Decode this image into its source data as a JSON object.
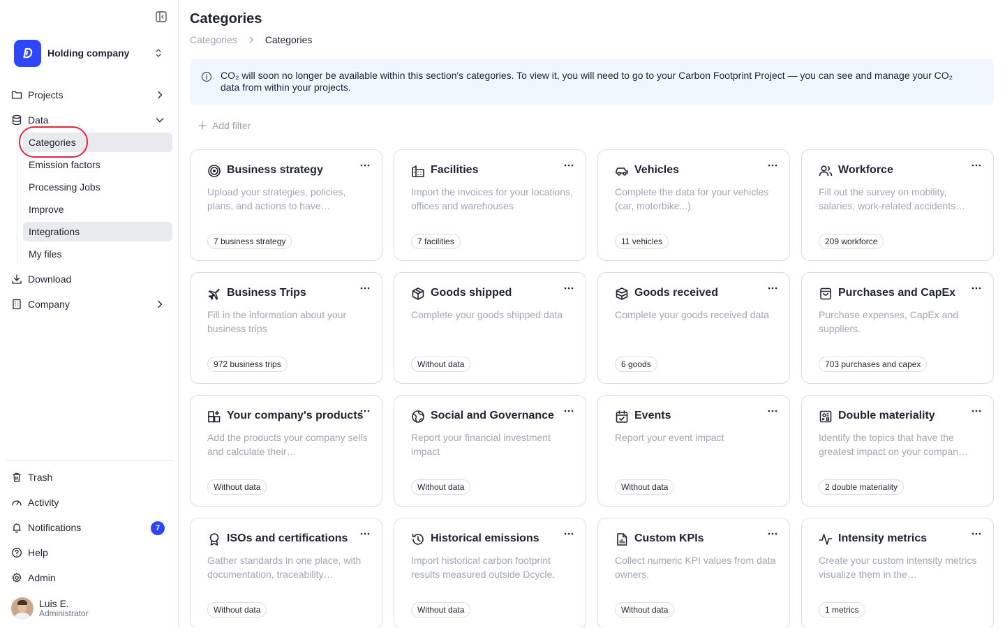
{
  "sidebar": {
    "org_name": "Holding company",
    "nav": {
      "projects": "Projects",
      "data": "Data",
      "download": "Download",
      "company": "Company"
    },
    "data_sub": [
      "Categories",
      "Emission factors",
      "Processing Jobs",
      "Improve",
      "Integrations",
      "My files"
    ],
    "bottom": {
      "trash": "Trash",
      "activity": "Activity",
      "notifications": "Notifications",
      "notifications_count": "7",
      "help": "Help",
      "admin": "Admin"
    },
    "user": {
      "name": "Luis E.",
      "role": "Administrator"
    }
  },
  "main": {
    "title": "Categories",
    "breadcrumb": [
      "Categories",
      "Categories"
    ],
    "banner": "CO₂ will soon no longer be available within this section's categories. To view it, you will need to go to your Carbon Footprint Project — you can see and manage your CO₂ data from within your projects.",
    "add_filter": "Add filter",
    "cards": [
      {
        "title": "Business strategy",
        "desc": "Upload your strategies, policies, plans, and actions to have…",
        "tag": "7 business strategy",
        "icon": "target-icon"
      },
      {
        "title": "Facilities",
        "desc": "Import the invoices for your locations, offices and warehouses",
        "tag": "7 facilities",
        "icon": "building-icon"
      },
      {
        "title": "Vehicles",
        "desc": "Complete the data for your vehicles (car, motorbike...)",
        "tag": "11 vehicles",
        "icon": "car-icon"
      },
      {
        "title": "Workforce",
        "desc": "Fill out the survey on mobility, salaries, work-related accidents…",
        "tag": "209 workforce",
        "icon": "users-icon"
      },
      {
        "title": "Business Trips",
        "desc": "Fill in the information about your business trips",
        "tag": "972 business trips",
        "icon": "plane-icon"
      },
      {
        "title": "Goods shipped",
        "desc": "Complete your goods shipped data",
        "tag": "Without data",
        "icon": "package-icon"
      },
      {
        "title": "Goods received",
        "desc": "Complete your goods received data",
        "tag": "6 goods",
        "icon": "box-icon"
      },
      {
        "title": "Purchases and CapEx",
        "desc": "Purchase expenses, CapEx and suppliers.",
        "tag": "703 purchases and capex",
        "icon": "shopping-bag-icon"
      },
      {
        "title": "Your company's products",
        "desc": "Add the products your company sells and calculate their…",
        "tag": "Without data",
        "icon": "grid-plus-icon"
      },
      {
        "title": "Social and Governance",
        "desc": "Report your financial investment impact",
        "tag": "Without data",
        "icon": "globe-icon"
      },
      {
        "title": "Events",
        "desc": "Report your event impact",
        "tag": "Without data",
        "icon": "calendar-icon"
      },
      {
        "title": "Double materiality",
        "desc": "Identify the topics that have the greatest impact on your compan…",
        "tag": "2 double materiality",
        "icon": "matrix-icon"
      },
      {
        "title": "ISOs and certifications",
        "desc": "Gather standards in one place, with documentation, traceability…",
        "tag": "Without data",
        "icon": "award-icon"
      },
      {
        "title": "Historical emissions",
        "desc": "Import historical carbon footprint results measured outside Dcycle.",
        "tag": "Without data",
        "icon": "history-icon"
      },
      {
        "title": "Custom KPIs",
        "desc": "Collect numeric KPI values from data owners.",
        "tag": "Without data",
        "icon": "file-chart-icon"
      },
      {
        "title": "Intensity metrics",
        "desc": "Create your custom intensity metrics visualize them in the…",
        "tag": "1 metrics",
        "icon": "activity-line-icon"
      }
    ]
  }
}
